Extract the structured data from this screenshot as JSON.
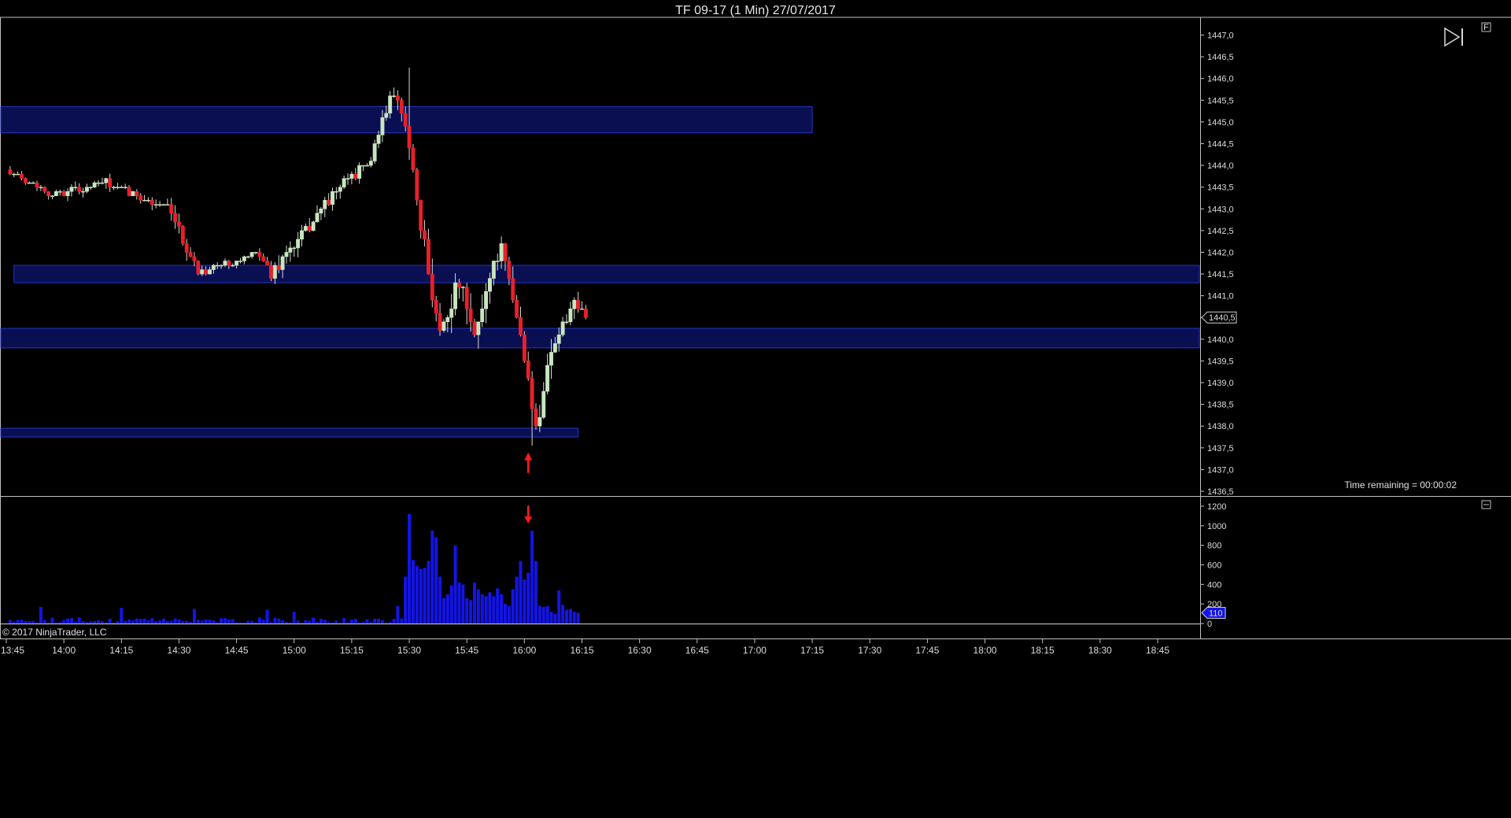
{
  "window": {
    "title": "TF 09-17 (1 Min)  27/07/2017"
  },
  "icons": {
    "panel_badge": "F",
    "volume_panel_icon": "panel-icon",
    "toolbar_icon": "skip-to-end-icon"
  },
  "status": {
    "time_remaining": "Time remaining = 00:00:02",
    "copyright": "© 2017 NinjaTrader, LLC"
  },
  "colors": {
    "up": "#c8e6c0",
    "down": "#e8202a",
    "zone_fill": "#0a0f52",
    "zone_stroke": "#2535c8",
    "volume": "#1414e6",
    "marker": "#ff1a1a"
  },
  "chart_data": [
    {
      "type": "candlestick",
      "name": "price",
      "ylim": [
        1436.5,
        1447.0
      ],
      "yticks": [
        "1436,5",
        "1437,0",
        "1437,5",
        "1438,0",
        "1438,5",
        "1439,0",
        "1439,5",
        "1440,0",
        "1440,5",
        "1441,0",
        "1441,5",
        "1442,0",
        "1442,5",
        "1443,0",
        "1443,5",
        "1444,0",
        "1444,5",
        "1445,0",
        "1445,5",
        "1446,0",
        "1446,5",
        "1447,0"
      ],
      "xticks": [
        "13:45",
        "14:00",
        "14:15",
        "14:30",
        "14:45",
        "15:00",
        "15:15",
        "15:30",
        "15:45",
        "16:00",
        "16:15",
        "16:30",
        "16:45",
        "17:00",
        "17:15",
        "17:30",
        "17:45",
        "18:00",
        "18:15",
        "18:30",
        "18:45"
      ],
      "last_price": "1440,5",
      "last_value": 1440.5,
      "zones": [
        {
          "from": "13:45",
          "to": "17:15",
          "low": 1444.75,
          "high": 1445.35
        },
        {
          "from": "13:47",
          "to": "19:00",
          "low": 1441.3,
          "high": 1441.7
        },
        {
          "from": "13:45",
          "to": "19:00",
          "low": 1439.8,
          "high": 1440.25
        },
        {
          "from": "13:45",
          "to": "16:14",
          "low": 1437.75,
          "high": 1437.95
        }
      ],
      "marker": {
        "time": "16:01",
        "price": 1437.5,
        "direction": "up"
      },
      "segments": [
        {
          "start": "13:46",
          "from": 1443.9,
          "to": 1443.35,
          "n": 12,
          "noise": 0.12
        },
        {
          "start": "13:58",
          "from": 1443.35,
          "to": 1443.6,
          "n": 14,
          "noise": 0.18
        },
        {
          "start": "14:12",
          "from": 1443.6,
          "to": 1443.0,
          "n": 16,
          "noise": 0.18
        },
        {
          "start": "14:28",
          "from": 1443.0,
          "to": 1441.55,
          "n": 8,
          "noise": 0.25
        },
        {
          "start": "14:36",
          "from": 1441.55,
          "to": 1441.95,
          "n": 16,
          "noise": 0.12
        },
        {
          "start": "14:52",
          "from": 1441.95,
          "to": 1441.5,
          "n": 3,
          "noise": 0.15
        },
        {
          "start": "14:55",
          "from": 1441.5,
          "to": 1442.6,
          "n": 10,
          "noise": 0.3
        },
        {
          "start": "15:05",
          "from": 1442.6,
          "to": 1443.55,
          "n": 8,
          "noise": 0.25
        },
        {
          "start": "15:13",
          "from": 1443.55,
          "to": 1444.1,
          "n": 8,
          "noise": 0.2
        },
        {
          "start": "15:21",
          "from": 1444.1,
          "to": 1445.55,
          "n": 5,
          "noise": 0.25
        },
        {
          "start": "15:26",
          "from": 1445.55,
          "to": 1445.1,
          "n": 4,
          "noise": 0.35
        },
        {
          "start": "15:30",
          "from": 1445.1,
          "to": 1443.0,
          "n": 3,
          "noise": 0.45
        },
        {
          "start": "15:33",
          "from": 1443.0,
          "to": 1440.2,
          "n": 6,
          "noise": 0.45
        },
        {
          "start": "15:39",
          "from": 1440.2,
          "to": 1441.3,
          "n": 5,
          "noise": 0.45
        },
        {
          "start": "15:44",
          "from": 1441.3,
          "to": 1440.0,
          "n": 4,
          "noise": 0.45
        },
        {
          "start": "15:48",
          "from": 1440.0,
          "to": 1441.5,
          "n": 4,
          "noise": 0.45
        },
        {
          "start": "15:52",
          "from": 1441.5,
          "to": 1442.1,
          "n": 3,
          "noise": 0.3
        },
        {
          "start": "15:55",
          "from": 1442.1,
          "to": 1440.1,
          "n": 5,
          "noise": 0.4
        },
        {
          "start": "16:00",
          "from": 1440.1,
          "to": 1437.95,
          "n": 4,
          "noise": 0.3
        },
        {
          "start": "16:04",
          "from": 1437.95,
          "to": 1439.8,
          "n": 4,
          "noise": 0.4
        },
        {
          "start": "16:08",
          "from": 1439.8,
          "to": 1440.8,
          "n": 6,
          "noise": 0.3
        },
        {
          "start": "16:14",
          "from": 1440.8,
          "to": 1440.5,
          "n": 3,
          "noise": 0.3
        }
      ]
    },
    {
      "type": "bar",
      "name": "volume",
      "ylim": [
        0,
        1300
      ],
      "yticks": [
        "0",
        "200",
        "400",
        "600",
        "800",
        "1000",
        "1200"
      ],
      "last_volume": "110",
      "last_value": 110,
      "peaks": [
        {
          "time": "13:54",
          "value": 170
        },
        {
          "time": "14:15",
          "value": 160
        },
        {
          "time": "14:34",
          "value": 150
        },
        {
          "time": "14:53",
          "value": 140
        },
        {
          "time": "15:00",
          "value": 120
        },
        {
          "time": "15:27",
          "value": 180
        },
        {
          "time": "15:29",
          "value": 480
        },
        {
          "time": "15:30",
          "value": 1120
        },
        {
          "time": "15:31",
          "value": 650
        },
        {
          "time": "15:32",
          "value": 590
        },
        {
          "time": "15:33",
          "value": 560
        },
        {
          "time": "15:34",
          "value": 570
        },
        {
          "time": "15:35",
          "value": 640
        },
        {
          "time": "15:36",
          "value": 950
        },
        {
          "time": "15:37",
          "value": 880
        },
        {
          "time": "15:38",
          "value": 480
        },
        {
          "time": "15:39",
          "value": 260
        },
        {
          "time": "15:40",
          "value": 300
        },
        {
          "time": "15:41",
          "value": 390
        },
        {
          "time": "15:42",
          "value": 800
        },
        {
          "time": "15:43",
          "value": 420
        },
        {
          "time": "15:44",
          "value": 400
        },
        {
          "time": "15:45",
          "value": 260
        },
        {
          "time": "15:46",
          "value": 240
        },
        {
          "time": "15:47",
          "value": 420
        },
        {
          "time": "15:48",
          "value": 350
        },
        {
          "time": "15:49",
          "value": 300
        },
        {
          "time": "15:50",
          "value": 280
        },
        {
          "time": "15:51",
          "value": 320
        },
        {
          "time": "15:52",
          "value": 280
        },
        {
          "time": "15:53",
          "value": 360
        },
        {
          "time": "15:54",
          "value": 300
        },
        {
          "time": "15:55",
          "value": 200
        },
        {
          "time": "15:56",
          "value": 180
        },
        {
          "time": "15:57",
          "value": 350
        },
        {
          "time": "15:58",
          "value": 480
        },
        {
          "time": "15:59",
          "value": 640
        },
        {
          "time": "16:00",
          "value": 450
        },
        {
          "time": "16:01",
          "value": 520
        },
        {
          "time": "16:02",
          "value": 950
        },
        {
          "time": "16:03",
          "value": 640
        },
        {
          "time": "16:04",
          "value": 180
        },
        {
          "time": "16:05",
          "value": 170
        },
        {
          "time": "16:06",
          "value": 180
        },
        {
          "time": "16:07",
          "value": 120
        },
        {
          "time": "16:08",
          "value": 100
        },
        {
          "time": "16:09",
          "value": 340
        },
        {
          "time": "16:10",
          "value": 190
        },
        {
          "time": "16:11",
          "value": 140
        },
        {
          "time": "16:12",
          "value": 150
        },
        {
          "time": "16:13",
          "value": 120
        },
        {
          "time": "16:14",
          "value": 110
        }
      ],
      "marker": {
        "time": "16:01",
        "value": 1160,
        "direction": "down"
      }
    }
  ]
}
